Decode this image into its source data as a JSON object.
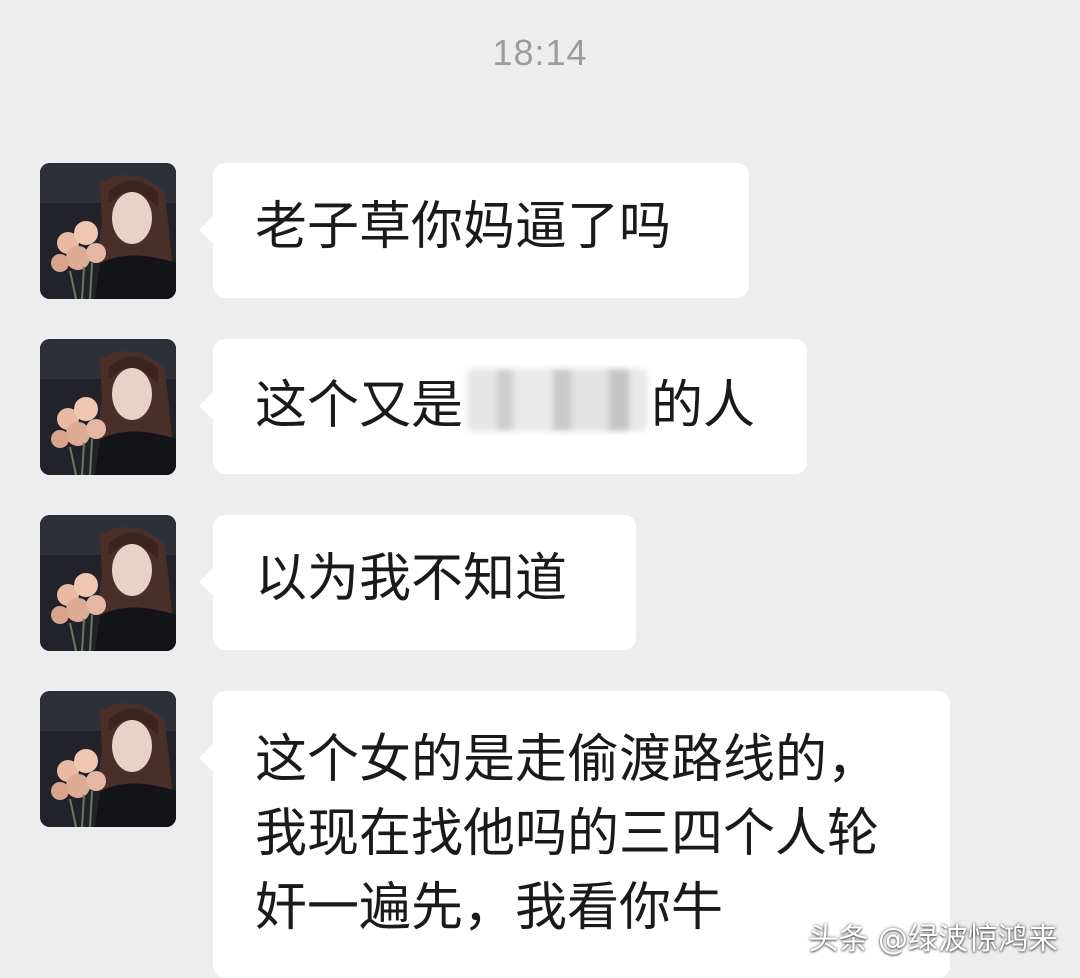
{
  "chat": {
    "timestamp": "18:14",
    "messages": [
      {
        "sender": "contact",
        "avatar": "contact-avatar-woman-with-roses",
        "text_before": "老子草你妈逼了吗",
        "text_after": "",
        "redacted": false
      },
      {
        "sender": "contact",
        "avatar": "contact-avatar-woman-with-roses",
        "text_before": "这个又是",
        "text_after": "的人",
        "redacted": true
      },
      {
        "sender": "contact",
        "avatar": "contact-avatar-woman-with-roses",
        "text_before": "以为我不知道",
        "text_after": "",
        "redacted": false
      },
      {
        "sender": "contact",
        "avatar": "contact-avatar-woman-with-roses",
        "text_before": "这个女的是走偷渡路线的，\n我现在找他吗的三四个人轮\n奸一遍先，我看你牛",
        "text_after": "",
        "redacted": false
      }
    ]
  },
  "watermark": "头条 @绿波惊鸿来",
  "colors": {
    "background": "#ededed",
    "bubble": "#ffffff",
    "text": "#1a1a1a",
    "timestamp": "#9c9c9c"
  }
}
